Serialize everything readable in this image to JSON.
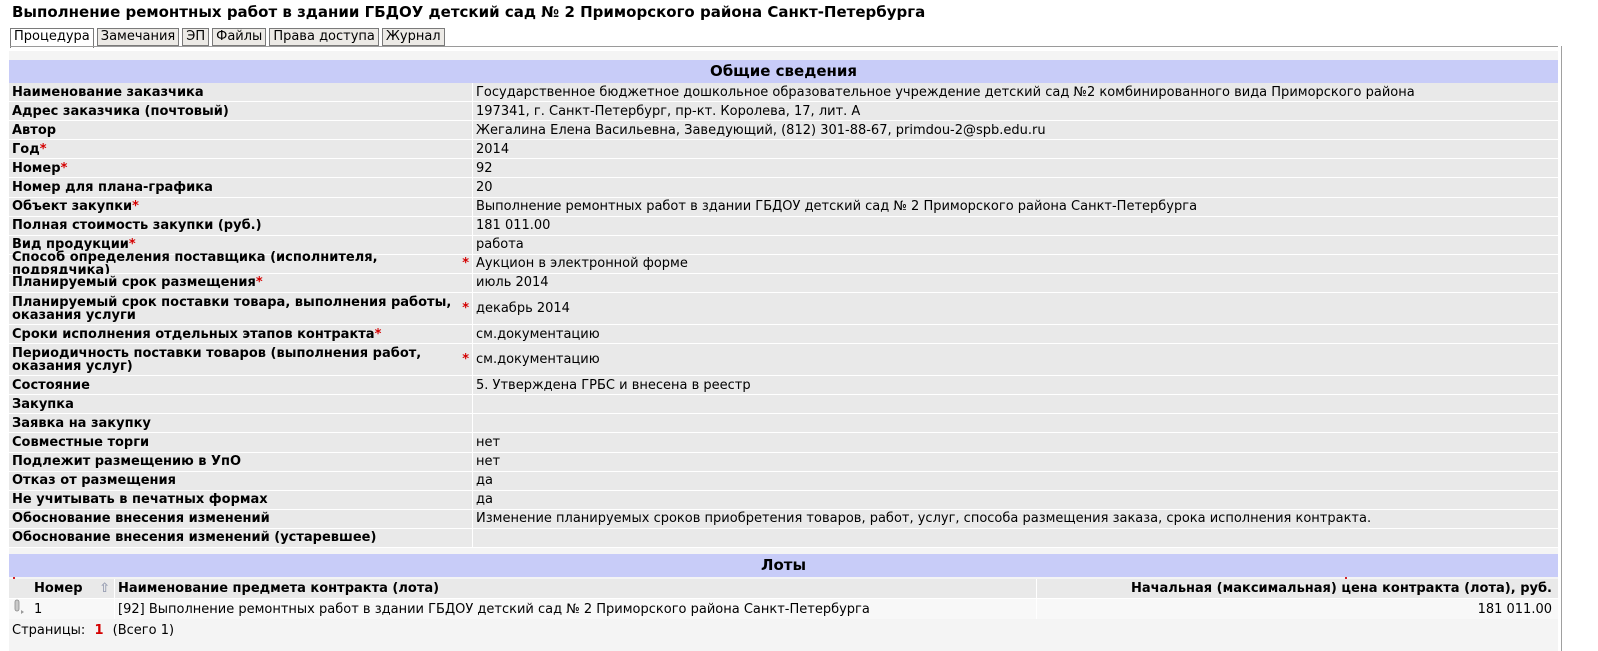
{
  "page_title": "Выполнение ремонтных работ в здании ГБДОУ детский сад № 2 Приморского района Санкт-Петербурга",
  "tabs": [
    {
      "label": "Процедура",
      "active": true
    },
    {
      "label": "Замечания",
      "active": false
    },
    {
      "label": "ЭП",
      "active": false
    },
    {
      "label": "Файлы",
      "active": false
    },
    {
      "label": "Права доступа",
      "active": false
    },
    {
      "label": "Журнал",
      "active": false
    }
  ],
  "general": {
    "heading": "Общие сведения",
    "rows": [
      {
        "label": "Наименование заказчика",
        "required": false,
        "value": "Государственное бюджетное дошкольное образовательное учреждение детский сад №2 комбинированного вида Приморского района"
      },
      {
        "label": "Адрес заказчика (почтовый)",
        "required": false,
        "value": "197341, г. Санкт-Петербург, пр-кт. Королева, 17, лит. А"
      },
      {
        "label": "Автор",
        "required": false,
        "value": "Жегалина Елена Васильевна, Заведующий, (812) 301-88-67, primdou-2@spb.edu.ru"
      },
      {
        "label": "Год",
        "required": true,
        "value": "2014"
      },
      {
        "label": "Номер",
        "required": true,
        "value": "92"
      },
      {
        "label": "Номер для плана-графика",
        "required": false,
        "value": "20"
      },
      {
        "label": "Объект закупки",
        "required": true,
        "value": "Выполнение ремонтных работ в здании ГБДОУ детский сад № 2 Приморского района Санкт-Петербурга"
      },
      {
        "label": "Полная стоимость закупки (руб.)",
        "required": false,
        "value": "181 011.00"
      },
      {
        "label": "Вид продукции",
        "required": true,
        "value": "работа"
      },
      {
        "label": "Способ определения поставщика (исполнителя, подрядчика)",
        "required": true,
        "value": "Аукцион в электронной форме"
      },
      {
        "label": "Планируемый срок размещения",
        "required": true,
        "value": "июль 2014"
      },
      {
        "label": "Планируемый срок поставки товара, выполнения работы, оказания услуги",
        "required": true,
        "value": "декабрь 2014",
        "tall": true
      },
      {
        "label": "Сроки исполнения отдельных этапов контракта",
        "required": true,
        "value": "см.документацию"
      },
      {
        "label": "Периодичность поставки товаров (выполнения работ, оказания услуг)",
        "required": true,
        "value": "см.документацию",
        "tall": true
      },
      {
        "label": "Состояние",
        "required": false,
        "value": "5. Утверждена ГРБС и внесена в реестр"
      },
      {
        "label": "Закупка",
        "required": false,
        "value": ""
      },
      {
        "label": "Заявка на закупку",
        "required": false,
        "value": ""
      },
      {
        "label": "Совместные торги",
        "required": false,
        "value": "нет"
      },
      {
        "label": "Подлежит размещению в УпО",
        "required": false,
        "value": "нет"
      },
      {
        "label": "Отказ от размещения",
        "required": false,
        "value": "да"
      },
      {
        "label": "Не учитывать в печатных формах",
        "required": false,
        "value": "да"
      },
      {
        "label": "Обоснование внесения изменений",
        "required": false,
        "value": "Изменение планируемых сроков приобретения товаров, работ, услуг, способа размещения заказа, срока исполнения контракта."
      },
      {
        "label": "Обоснование внесения изменений (устаревшее)",
        "required": false,
        "value": ""
      }
    ]
  },
  "lots": {
    "heading": "Лоты",
    "columns": {
      "number": "Номер",
      "name": "Наименование предмета контракта (лота)",
      "price": "Начальная (максимальная) цена контракта (лота), руб."
    },
    "rows": [
      {
        "number": "1",
        "name": "[92] Выполнение ремонтных работ в здании ГБДОУ детский сад № 2 Приморского района Санкт-Петербурга",
        "price": "181 011.00"
      }
    ]
  },
  "pager": {
    "label": "Страницы:",
    "current": "1",
    "total": "(Всего 1)"
  }
}
